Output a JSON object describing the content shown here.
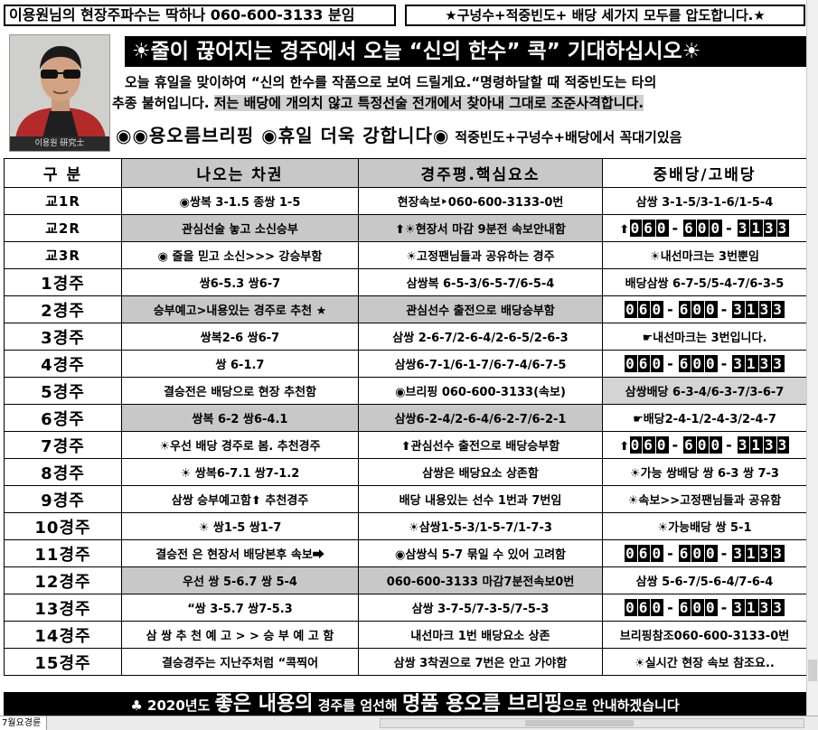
{
  "header": {
    "top_left": "이용원님의 현장주파수는 딱하나 060-600-3133 분임",
    "top_right": "★구넝수+적중빈도+ 배당 세가지 모두를 압도합니다.★"
  },
  "hero": {
    "photo_caption": "이용원 研究士",
    "title": "☀줄이 끊어지는 경주에서 오늘 “신의 한수” 콕” 기대하십시오☀",
    "line1": "오늘 휴일을 맞이하여  “신의 한수를 작품으로 보여 드릴게요.“명령하달할 때 적중빈도는 타의",
    "line2_prefix": "추종 불허입니다. ",
    "line2_highlight": "저는 배당에 개의치 않고 특정선술 전개에서 찾아내 그대로 조준사격합니다.",
    "foot_big": "◉◉용오름브리핑 ◉휴일 더욱 강합니다◉",
    "foot_small": "적중빈도+구넝수+배당에서 꼭대기있음"
  },
  "table": {
    "headers": [
      "구 분",
      "나오는  차권",
      "경주평.핵심요소",
      "중배당/고배당"
    ],
    "rows": [
      {
        "label": "교1R",
        "c1": "◉쌍복 3-1.5 종쌍 1-5",
        "c2": "현장속보‣060-600-3133-0번",
        "c3": "삼쌍 3-1-5/3-1-6/1-5-4",
        "phone": false,
        "shade": false,
        "c3shade": false,
        "small": true
      },
      {
        "label": "교2R",
        "c1": "관심선술 놓고 소신승부",
        "c2": "⬆☀현장서 마감 9분전 속보안내함",
        "c3_prefix": "⬆",
        "c3": "060-600-3133",
        "phone": true,
        "shade": true,
        "c3shade": false,
        "small": true
      },
      {
        "label": "교3R",
        "c1": "◉  줄을 믿고 소신>>> 강승부함",
        "c2": "☀고정팬님들과 공유하는 경주",
        "c3": "☀내선마크는 3번뿐임",
        "phone": false,
        "shade": false,
        "c3shade": false,
        "small": true
      },
      {
        "label": "1경주",
        "c1": "쌍6-5.3  쌍6-7",
        "c2": "삼쌍복 6-5-3/6-5-7/6-5-4",
        "c3": "배당삼쌍 6-7-5/5-4-7/6-3-5",
        "phone": false,
        "shade": false,
        "c3shade": false,
        "small": false
      },
      {
        "label": "2경주",
        "c1": "승부예고>내용있는 경주로 추천 ★",
        "c2": "관심선수 출전으로 배당승부함",
        "c3": "060-600-3133",
        "phone": true,
        "shade": true,
        "c3shade": false,
        "small": false
      },
      {
        "label": "3경주",
        "c1": "쌍복2-6 쌍6-7",
        "c2": "삼쌍 2-6-7/2-6-4/2-6-5/2-6-3",
        "c3": "☛내선마크는 3번입니다.",
        "phone": false,
        "shade": false,
        "c3shade": false,
        "small": false
      },
      {
        "label": "4경주",
        "c1": "쌍 6-1.7",
        "c2": "삼쌍6-7-1/6-1-7/6-7-4/6-7-5",
        "c3": "060-600-3133",
        "phone": true,
        "shade": false,
        "c3shade": false,
        "small": false
      },
      {
        "label": "5경주",
        "c1": "결승전은 배당으로 현장 추천함",
        "c2": "◉브리핑 060-600-3133(속보)",
        "c3": "삼쌍배당 6-3-4/6-3-7/3-6-7",
        "phone": false,
        "shade": false,
        "c3shade": true,
        "small": false
      },
      {
        "label": "6경주",
        "c1": "쌍복 6-2  쌍6-4.1",
        "c2": "삼쌍6-2-4/2-6-4/6-2-7/6-2-1",
        "c3": "☛배당2-4-1/2-4-3/2-4-7",
        "phone": false,
        "shade": true,
        "c3shade": false,
        "small": false
      },
      {
        "label": "7경주",
        "c1": "☀우선 배당 경주로 봄. 추천경주",
        "c2": "⬆관심선수 출전으로 배당승부함",
        "c3_prefix": "⬆",
        "c3": "060-600-3133",
        "phone": true,
        "shade": false,
        "c3shade": false,
        "small": false
      },
      {
        "label": "8경주",
        "c1": "☀ 쌍복6-7.1  쌍7-1.2",
        "c2": "삼쌍은 배당요소 상존함",
        "c3": "☀가능 쌍배당 쌍 6-3 쌍 7-3",
        "phone": false,
        "shade": false,
        "c3shade": false,
        "small": false
      },
      {
        "label": "9경주",
        "c1": "삼쌍 승부예고함⬆ 추천경주",
        "c2": "배당 내용있는 선수 1번과 7번임",
        "c3": "☀속보>>고정팬님들과 공유함",
        "phone": false,
        "shade": false,
        "c3shade": false,
        "small": false
      },
      {
        "label": "10경주",
        "c1": "☀ 쌍1-5 쌍1-7",
        "c2": "☀삼쌍1-5-3/1-5-7/1-7-3",
        "c3": "☀가능배당 쌍 5-1",
        "phone": false,
        "shade": false,
        "c3shade": false,
        "small": false
      },
      {
        "label": "11경주",
        "c1": "결승전 은 현장서 배당본후 속보⮕",
        "c2": "◉삼쌍식 5-7 묶일 수 있어 고려함",
        "c3": "060-600-3133",
        "phone": true,
        "shade": false,
        "c3shade": false,
        "small": false
      },
      {
        "label": "12경주",
        "c1": "우선 쌍 5-6.7 쌍 5-4",
        "c2": "060-600-3133 마감7분전속보0번",
        "c3": "삼쌍 5-6-7/5-6-4/7-6-4",
        "phone": false,
        "shade": true,
        "c3shade": false,
        "small": false
      },
      {
        "label": "13경주",
        "c1": "“쌍 3-5.7 쌍7-5.3",
        "c2": "삼쌍 3-7-5/7-3-5/7-5-3",
        "c3": "060-600-3133",
        "phone": true,
        "shade": false,
        "c3shade": false,
        "small": false
      },
      {
        "label": "14경주",
        "c1": "삼 쌍 추 천 예 고 > > 승 부 예 고 함",
        "c2": "내선마크 1번 배당요소 상존",
        "c3": "브리핑참조060-600-3133-0번",
        "phone": false,
        "shade": false,
        "c3shade": false,
        "small": false
      },
      {
        "label": "15경주",
        "c1": "결승경주는 지난주처럼 “콕찍어",
        "c2": "삼쌍 3착권으로 7번은 안고 가야함",
        "c3": "☀실시간 현장 속보 참조요..",
        "phone": false,
        "shade": false,
        "c3shade": false,
        "small": false
      }
    ]
  },
  "banner": {
    "p1": "♣ 2020년도 ",
    "p2": "좋은 내용의",
    "p3": " 경주를 엄선해 ",
    "p4": "명품 용오름 브리핑",
    "p5": "으로 안내하겠습니다"
  },
  "sheet": {
    "tab": "7월요경륜"
  }
}
